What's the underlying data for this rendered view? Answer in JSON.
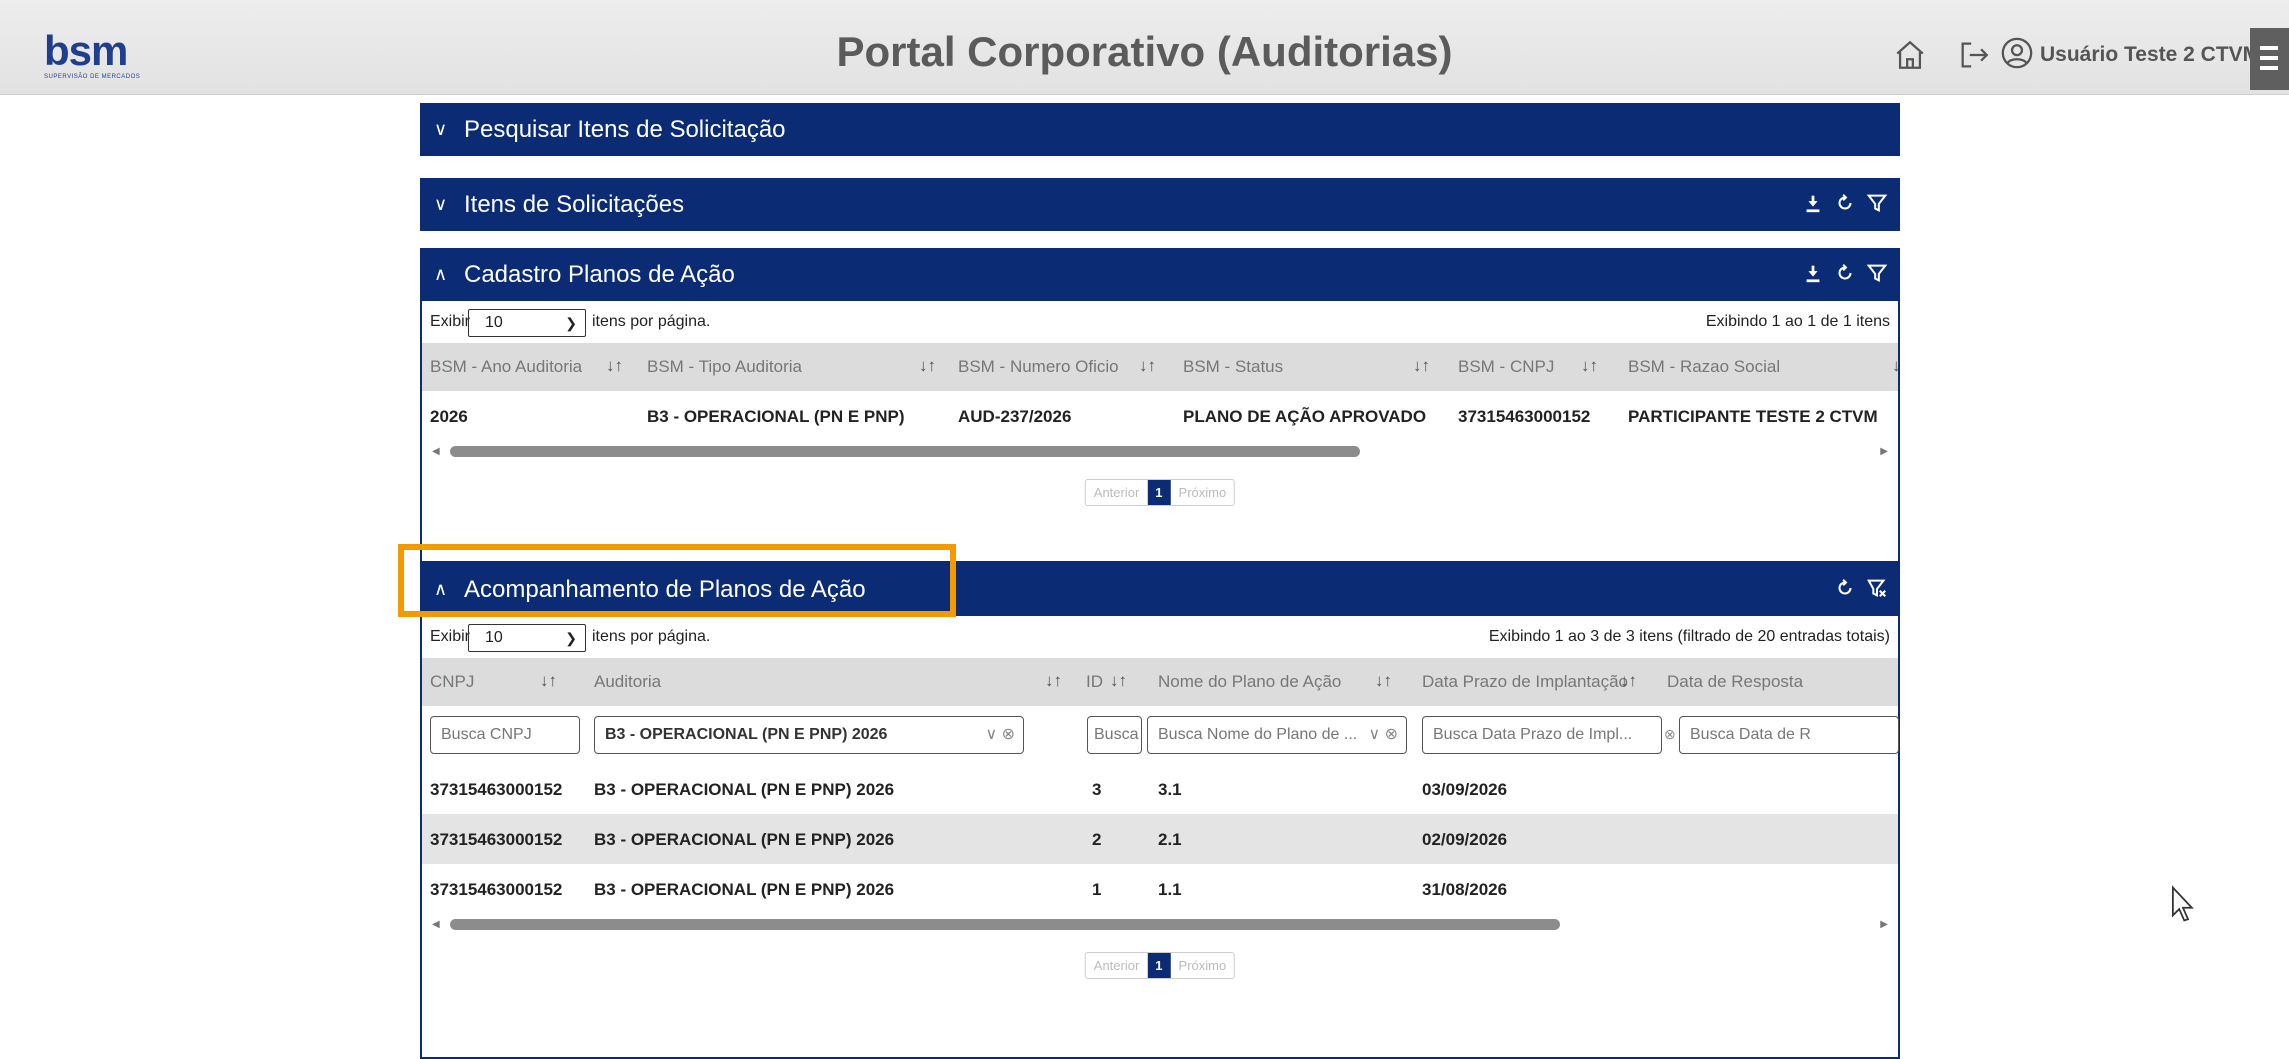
{
  "header": {
    "logo_text": "bsm",
    "logo_sub": "SUPERVISÃO DE MERCADOS",
    "title": "Portal Corporativo (Auditorias)",
    "user": "Usuário Teste 2 CTVM",
    "icons": [
      "home-icon",
      "logout-icon",
      "user-icon",
      "menu-icon"
    ]
  },
  "panels": {
    "search": {
      "title": "Pesquisar Itens de Solicitação"
    },
    "items": {
      "title": "Itens de Solicitações"
    },
    "cadastro": {
      "title": "Cadastro Planos de Ação",
      "length_label_prefix": "Exibir",
      "length_value": "10",
      "length_label_suffix": "itens por página.",
      "info": "Exibindo 1 ao 1 de 1 itens",
      "columns": [
        "BSM - Ano Auditoria",
        "BSM - Tipo Auditoria",
        "BSM - Numero Oficio",
        "BSM - Status",
        "BSM - CNPJ",
        "BSM - Razao Social"
      ],
      "rows": [
        [
          "2026",
          "B3 - OPERACIONAL (PN E PNP)",
          "AUD-237/2026",
          "PLANO DE AÇÃO APROVADO",
          "37315463000152",
          "PARTICIPANTE TESTE 2 CTVM"
        ]
      ],
      "pager": {
        "prev": "Anterior",
        "current": "1",
        "next": "Próximo"
      }
    },
    "acompanhamento": {
      "title": "Acompanhamento de Planos de Ação",
      "length_label_prefix": "Exibir",
      "length_value": "10",
      "length_label_suffix": "itens por página.",
      "info": "Exibindo 1 ao 3 de 3 itens (filtrado de 20 entradas totais)",
      "columns": [
        "CNPJ",
        "Auditoria",
        "ID",
        "Nome do Plano de Ação",
        "Data Prazo de Implantação",
        "Data de Resposta"
      ],
      "filters": {
        "cnpj": "Busca CNPJ",
        "auditoria": "B3 - OPERACIONAL (PN E PNP) 2026",
        "id": "Busca",
        "nome": "Busca Nome do Plano de ...",
        "prazo": "Busca Data Prazo de Impl...",
        "resposta": "Busca Data de R"
      },
      "rows": [
        [
          "37315463000152",
          "B3 - OPERACIONAL (PN E PNP) 2026",
          "3",
          "3.1",
          "03/09/2026"
        ],
        [
          "37315463000152",
          "B3 - OPERACIONAL (PN E PNP) 2026",
          "2",
          "2.1",
          "02/09/2026"
        ],
        [
          "37315463000152",
          "B3 - OPERACIONAL (PN E PNP) 2026",
          "1",
          "1.1",
          "31/08/2026"
        ]
      ],
      "pager": {
        "prev": "Anterior",
        "current": "1",
        "next": "Próximo"
      }
    }
  },
  "colors": {
    "header_blue": "#0b2c74",
    "highlight": "#f29a00"
  }
}
